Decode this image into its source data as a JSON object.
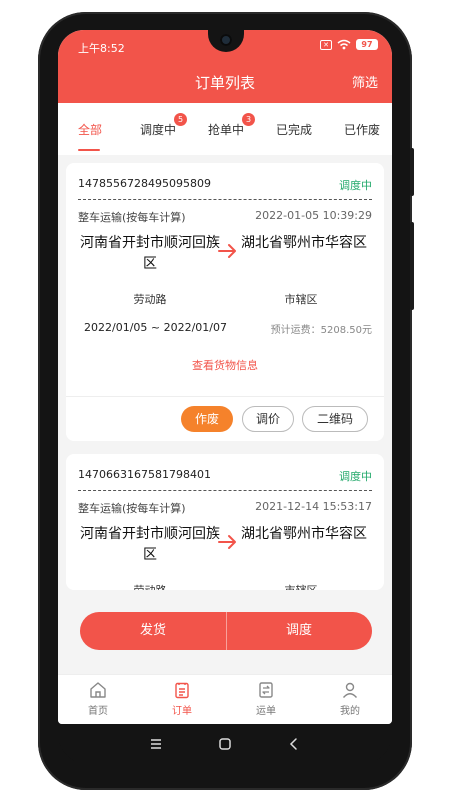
{
  "status_bar": {
    "time": "上午8:52",
    "battery": "97"
  },
  "header": {
    "title": "订单列表",
    "filter_label": "筛选"
  },
  "tabs": [
    {
      "label": "全部",
      "badge": null,
      "active": true
    },
    {
      "label": "调度中",
      "badge": "5",
      "active": false
    },
    {
      "label": "抢单中",
      "badge": "3",
      "active": false
    },
    {
      "label": "已完成",
      "badge": null,
      "active": false
    },
    {
      "label": "已作废",
      "badge": null,
      "active": false
    }
  ],
  "orders": [
    {
      "order_no": "1478556728495095809",
      "status": "调度中",
      "transport_type": "整车运输(按每车计算)",
      "datetime": "2022-01-05 10:39:29",
      "from_place": "河南省开封市顺河回族区",
      "to_place": "湖北省鄂州市华容区",
      "from_street": "劳动路",
      "to_street": "市辖区",
      "date_range": "2022/01/05 ~ 2022/01/07",
      "fee": "预计运费：5208.50元",
      "goods_link": "查看货物信息",
      "actions": {
        "void": "作废",
        "adjust": "调价",
        "qrcode": "二维码"
      }
    },
    {
      "order_no": "1470663167581798401",
      "status": "调度中",
      "transport_type": "整车运输(按每车计算)",
      "datetime": "2021-12-14 15:53:17",
      "from_place": "河南省开封市顺河回族区",
      "to_place": "湖北省鄂州市华容区",
      "from_street": "劳动路",
      "to_street": "市辖区"
    }
  ],
  "action_bar": {
    "ship": "发货",
    "dispatch": "调度"
  },
  "bottom_nav": [
    {
      "label": "首页",
      "icon": "home-icon",
      "active": false
    },
    {
      "label": "订单",
      "icon": "order-icon",
      "active": true
    },
    {
      "label": "运单",
      "icon": "waybill-icon",
      "active": false
    },
    {
      "label": "我的",
      "icon": "profile-icon",
      "active": false
    }
  ],
  "colors": {
    "accent": "#f2544a",
    "status_green": "#23a96b",
    "void_orange": "#f5822b"
  }
}
